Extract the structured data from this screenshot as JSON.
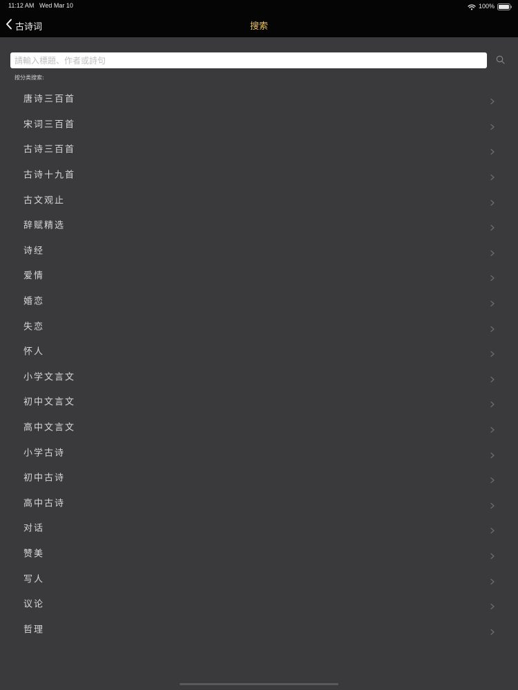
{
  "status_bar": {
    "time": "11:12 AM",
    "date": "Wed Mar 10",
    "battery": "100%"
  },
  "nav": {
    "back_label": "古诗词",
    "title": "搜索"
  },
  "search": {
    "placeholder": "請輸入標題、作者或詩句",
    "value": ""
  },
  "section_label": "按分类搜索:",
  "categories": [
    "唐诗三百首",
    "宋词三百首",
    "古诗三百首",
    "古诗十九首",
    "古文观止",
    "辞赋精选",
    "诗经",
    "爱情",
    "婚恋",
    "失恋",
    "怀人",
    "小学文言文",
    "初中文言文",
    "高中文言文",
    "小学古诗",
    "初中古诗",
    "高中古诗",
    "对话",
    "赞美",
    "写人",
    "议论",
    "哲理"
  ],
  "colors": {
    "background": "#3a393c",
    "nav_bar": "#050505",
    "title_accent": "#e6c15a",
    "item_text": "#d8d8d8",
    "chevron": "#6f6e72"
  },
  "icons": {
    "back": "chevron-left-icon",
    "search": "search-icon",
    "row": "chevron-right-icon",
    "wifi": "wifi-icon",
    "battery": "battery-icon"
  }
}
